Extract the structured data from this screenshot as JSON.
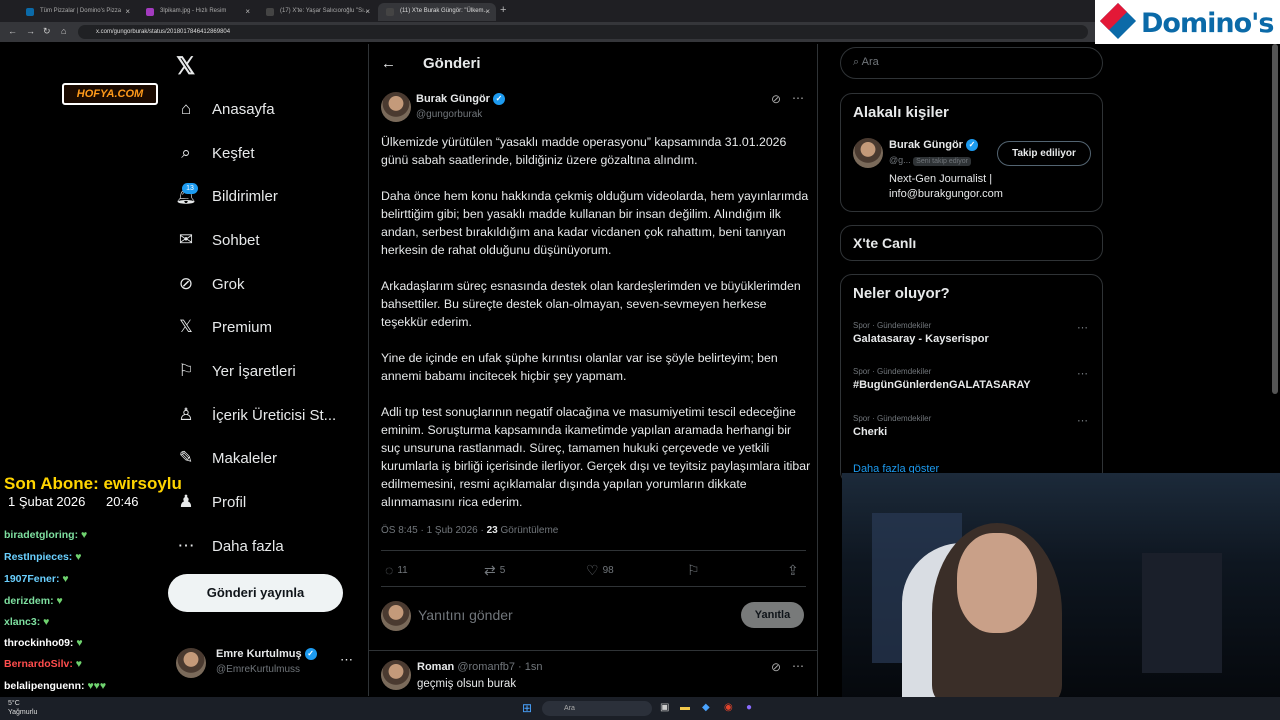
{
  "browser": {
    "tabs": [
      {
        "label": "Tüm Pizzalar | Domino's Pizza",
        "color": "#0b6aa8"
      },
      {
        "label": "3lpikam.jpg - Hızlı Resim",
        "color": "#a33bbf"
      },
      {
        "label": "(17) X'te: Yaşar Salıcıoroğlu \"Sı...",
        "color": "#333"
      },
      {
        "label": "(11) X'te Burak Güngör: \"Ülkem...",
        "color": "#333"
      }
    ],
    "url": "x.com/gungorburak/status/2018017846412869804"
  },
  "overlay": {
    "logo_text": "Domino's",
    "site_tag": "HOFYA.COM",
    "last_sub_label": "Son Abone: ewirsoylu",
    "date": "1 Şubat 2026",
    "time": "20:46",
    "chat": [
      {
        "user": "biradetgloring:",
        "color": "#7ee0a0"
      },
      {
        "user": "RestInpieces:",
        "color": "#6ad0ff"
      },
      {
        "user": "1907Fener:",
        "color": "#6ad0ff"
      },
      {
        "user": "derizdem:",
        "color": "#7ee0a0"
      },
      {
        "user": "xlanc3:",
        "color": "#7ee0a0"
      },
      {
        "user": "throckinho09:",
        "color": "#ffffff"
      },
      {
        "user": "BernardoSilv:",
        "color": "#ff4d4d"
      },
      {
        "user": "belalipenguenn:",
        "color": "#ffffff"
      }
    ]
  },
  "nav": {
    "items": [
      {
        "label": "Anasayfa",
        "icon": "home-icon"
      },
      {
        "label": "Keşfet",
        "icon": "search-icon"
      },
      {
        "label": "Bildirimler",
        "icon": "bell-icon"
      },
      {
        "label": "Sohbet",
        "icon": "mail-icon"
      },
      {
        "label": "Grok",
        "icon": "grok-icon"
      },
      {
        "label": "Premium",
        "icon": "x-logo-icon"
      },
      {
        "label": "Yer İşaretleri",
        "icon": "bookmark-icon"
      },
      {
        "label": "İçerik Üreticisi St...",
        "icon": "creator-icon"
      },
      {
        "label": "Makaleler",
        "icon": "article-icon"
      },
      {
        "label": "Profil",
        "icon": "profile-icon"
      },
      {
        "label": "Daha fazla",
        "icon": "more-icon"
      }
    ],
    "notif_count": "13",
    "post_button": "Gönderi yayınla",
    "account_name": "Emre Kurtulmuş",
    "account_handle": "@EmreKurtulmuss"
  },
  "post": {
    "header": "Gönderi",
    "author": "Burak Güngör",
    "handle": "@gungorburak",
    "paragraphs": [
      "Ülkemizde yürütülen “yasaklı madde operasyonu” kapsamında 31.01.2026 günü sabah saatlerinde, bildiğiniz üzere gözaltına alındım.",
      "Daha önce hem konu hakkında çekmiş olduğum videolarda, hem yayınlarımda belirttiğim gibi; ben yasaklı madde kullanan bir insan değilim. Alındığım ilk andan, serbest bırakıldığım ana kadar vicdanen çok rahattım, beni tanıyan herkesin de rahat olduğunu düşünüyorum.",
      "Arkadaşlarım süreç esnasında destek olan kardeşlerimden ve büyüklerimden bahsettiler. Bu süreçte destek olan-olmayan, seven-sevmeyen herkese teşekkür ederim.",
      "Yine de içinde en ufak şüphe kırıntısı olanlar var ise şöyle belirteyim; ben annemi babamı incitecek hiçbir şey yapmam.",
      "Adli tıp test sonuçlarının negatif olacağına ve masumiyetimi tescil edeceğine eminim. Soruşturma kapsamında ikametimde yapılan aramada herhangi bir suç unsuruna rastlanmadı. Süreç, tamamen hukuki çerçevede ve yetkili kurumlarla iş birliği içerisinde ilerliyor. Gerçek dışı ve teyitsiz paylaşımlara itibar edilmemesini, resmi açıklamalar dışında yapılan yorumların dikkate alınmamasını rica ederim."
    ],
    "meta_time": "ÖS 8:45 · 1 Şub 2026 ·",
    "views_count": "23",
    "views_label": "Görüntüleme",
    "replies": "11",
    "reposts": "5",
    "likes": "98",
    "reply_placeholder": "Yanıtını gönder",
    "reply_button": "Yanıtla"
  },
  "reply": {
    "author": "Roman",
    "handle": "@romanfb7",
    "time": "· 1sn",
    "text": "geçmiş olsun burak"
  },
  "sidebar": {
    "search_placeholder": "Ara",
    "related_title": "Alakalı kişiler",
    "person_name": "Burak Güngör",
    "person_handle": "@g...",
    "follows_you": "Seni takip ediyor",
    "follow_button": "Takip ediliyor",
    "bio": "Next-Gen Journalist | info@burakgungor.com",
    "live_title": "X'te Canlı",
    "trends_title": "Neler oluyor?",
    "trends": [
      {
        "meta": "Spor · Gündemdekiler",
        "name": "Galatasaray - Kayserispor"
      },
      {
        "meta": "Spor · Gündemdekiler",
        "name": "#BugünGünlerdenGALATASARAY"
      },
      {
        "meta": "Spor · Gündemdekiler",
        "name": "Cherki"
      }
    ],
    "show_more": "Daha fazla göster"
  },
  "taskbar": {
    "weather": "5°C",
    "weather_desc": "Yağmurlu",
    "search": "Ara"
  }
}
